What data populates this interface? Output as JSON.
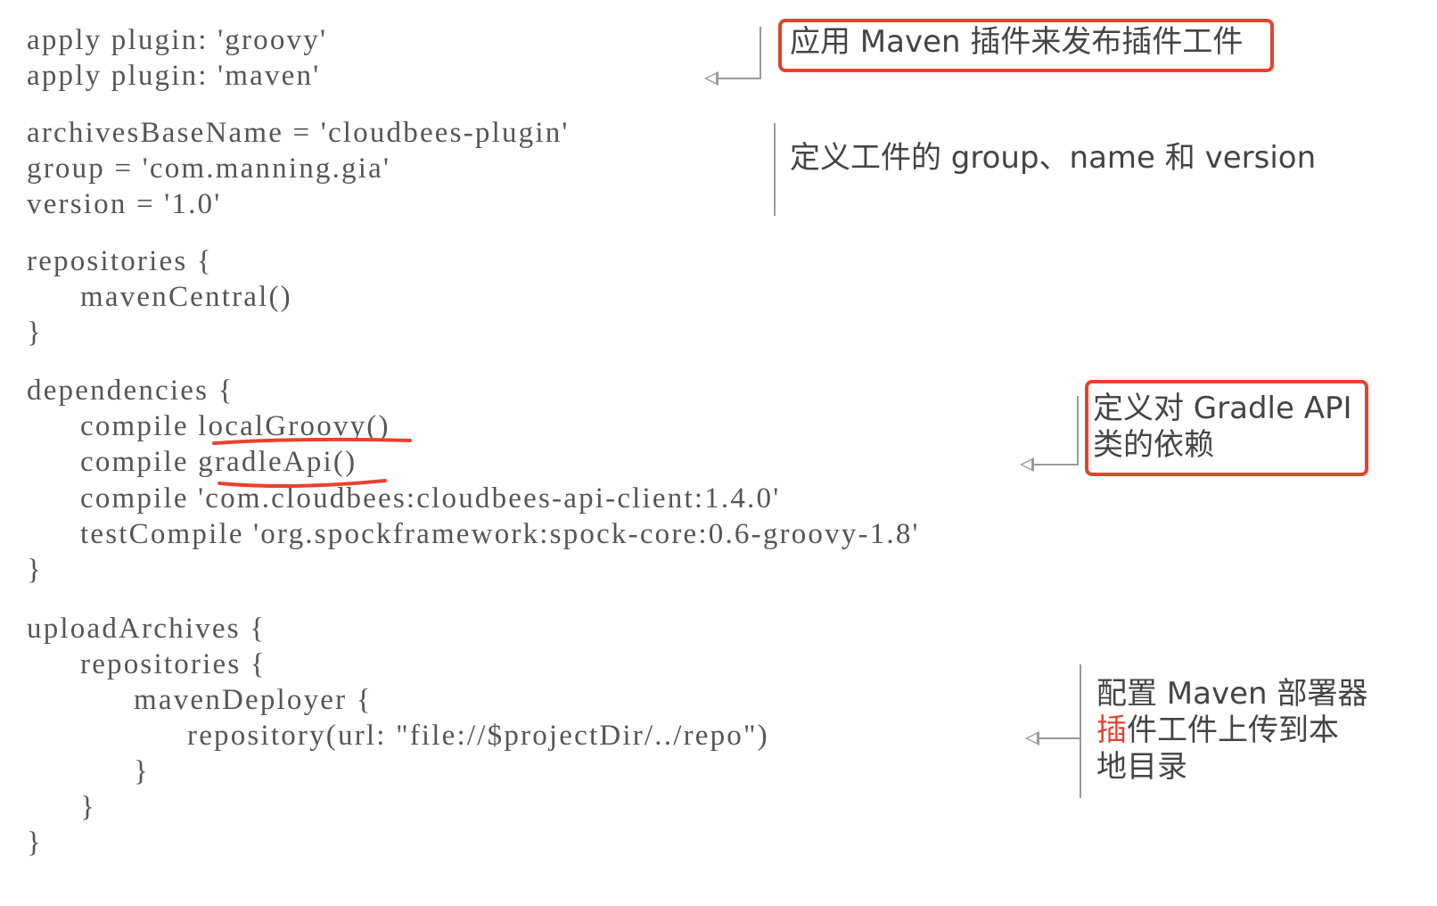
{
  "code_lines": [
    "apply plugin: 'groovy'",
    "apply plugin: 'maven'",
    "archivesBaseName = 'cloudbees-plugin'",
    "group = 'com.manning.gia'",
    "version = '1.0'",
    "repositories {",
    "mavenCentral()",
    "}",
    "dependencies {",
    "compile localGroovy()",
    "compile gradleApi()",
    "compile 'com.cloudbees:cloudbees-api-client:1.4.0'",
    "testCompile 'org.spockframework:spock-core:0.6-groovy-1.8'",
    "}",
    "uploadArchives {",
    "repositories {",
    "mavenDeployer {",
    "repository(url: \"file://$projectDir/../repo\")",
    "}",
    "}",
    "}"
  ],
  "annotations": {
    "maven_plugin": "应用 Maven 插件来发布插件工件",
    "group_name_version": "定义工件的 group、name 和 version",
    "gradle_api_line1": "定义对 Gradle API",
    "gradle_api_line2": "类的依赖",
    "deployer_line1": "配置 Maven 部署器",
    "deployer_line2_mark": "插",
    "deployer_line2_rest": "件工件上传到本",
    "deployer_line3": "地目录"
  },
  "colors": {
    "highlight": "#e8412c",
    "code_text": "#555555",
    "callout_line": "#999999"
  }
}
